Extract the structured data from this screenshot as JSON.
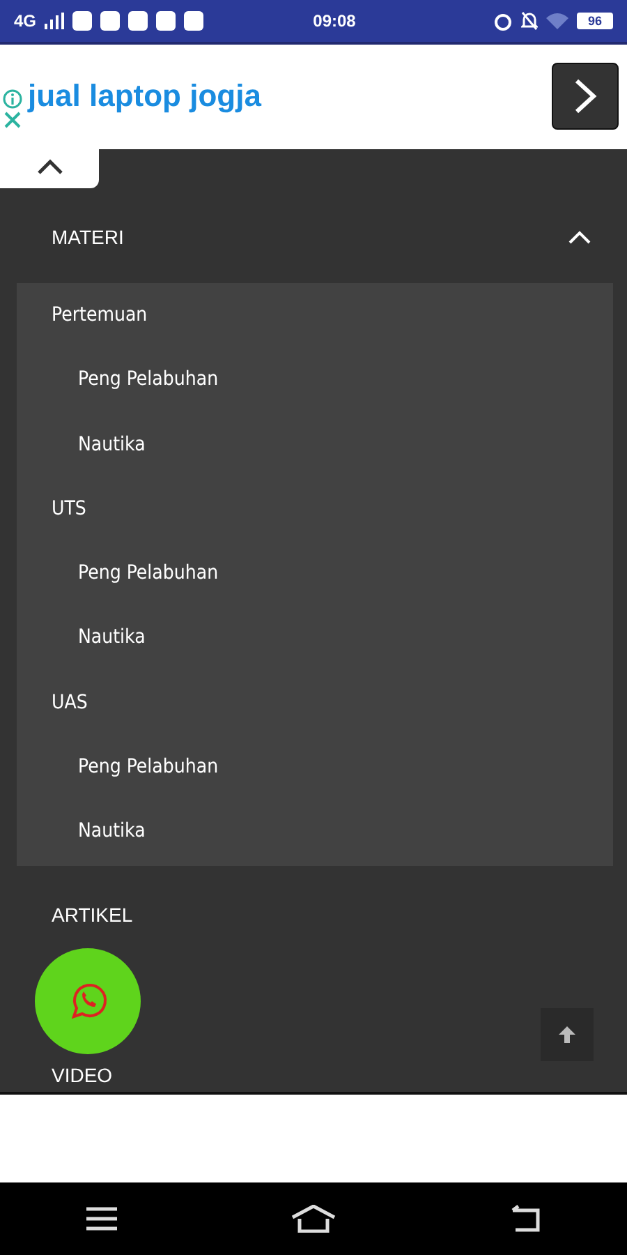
{
  "status_bar": {
    "network": "4G",
    "time": "09:08",
    "battery": "96"
  },
  "ad": {
    "text": "jual laptop jogja"
  },
  "menu": {
    "sections": [
      {
        "label": "MATERI",
        "expanded": true,
        "children": [
          {
            "label": "Pertemuan",
            "children": [
              {
                "label": "Peng Pelabuhan"
              },
              {
                "label": "Nautika"
              }
            ]
          },
          {
            "label": "UTS",
            "children": [
              {
                "label": "Peng Pelabuhan"
              },
              {
                "label": "Nautika"
              }
            ]
          },
          {
            "label": "UAS",
            "children": [
              {
                "label": "Peng Pelabuhan"
              },
              {
                "label": "Nautika"
              }
            ]
          }
        ]
      },
      {
        "label": "ARTIKEL"
      },
      {
        "label": "VIDEO"
      }
    ]
  }
}
